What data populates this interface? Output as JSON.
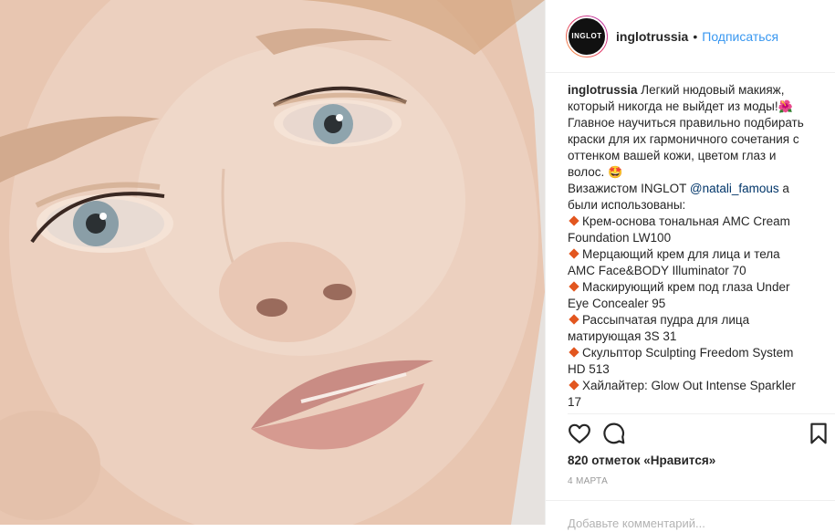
{
  "post": {
    "username": "inglotrussia",
    "avatar_text": "INGLOT",
    "separator": "•",
    "follow_label": "Подписаться",
    "caption_username": "inglotrussia",
    "caption_intro_lines": [
      " Легкий нюдовый макияж,",
      "который никогда не выйдет из моды!",
      "Главное научиться правильно подбирать",
      "краски для их гармоничного сочетания с",
      "оттенком вашей кожи, цветом глаз и",
      "волос."
    ],
    "artist_line_prefix": "Визажистом INGLOT ",
    "artist_mention": "@natali_famous",
    "artist_line_suffix": " а",
    "artist_line_2": "были использованы:",
    "products": [
      {
        "line1": "Крем-основа тональная AMC Cream",
        "line2": "Foundation LW100"
      },
      {
        "line1": "Мерцающий крем для лица и тела",
        "line2": "AMC Face&BODY Illuminator 70"
      },
      {
        "line1": "Маскирующий крем под глаза Under",
        "line2": "Eye Concealer 95"
      },
      {
        "line1": "Рассыпчатая пудра для лица",
        "line2": "матирующая 3S 31"
      },
      {
        "line1": "Скульптор Sculpting Freedom System",
        "line2": "HD 513"
      },
      {
        "line1": "Хайлайтер: Glow Out Intense Sparkler",
        "line2": "17"
      }
    ],
    "likes_text": "820 отметок «Нравится»",
    "date_text": "4 МАРТА",
    "comment_placeholder": "Добавьте комментарий..."
  },
  "icons": {
    "like": "heart-outline-icon",
    "comment": "speech-bubble-icon",
    "save": "bookmark-icon",
    "flower_emoji": "flower-emoji",
    "star_eyes_emoji": "star-struck-emoji",
    "bullet": "orange-diamond-icon"
  },
  "colors": {
    "link": "#3897f0",
    "mention": "#003569",
    "bullet": "#e2561f",
    "text": "#262626",
    "muted": "#999999"
  }
}
